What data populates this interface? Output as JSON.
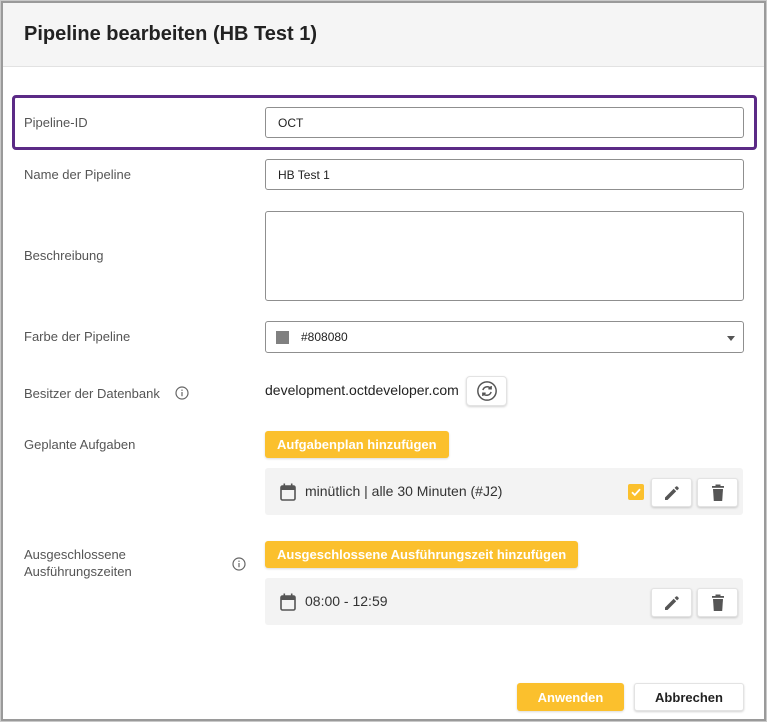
{
  "dialog": {
    "title": "Pipeline bearbeiten (HB Test 1)"
  },
  "fields": {
    "pipeline_id": {
      "label": "Pipeline-ID",
      "value": "OCT"
    },
    "name": {
      "label": "Name der Pipeline",
      "value": "HB Test 1"
    },
    "description": {
      "label": "Beschreibung",
      "value": ""
    },
    "color": {
      "label": "Farbe der Pipeline",
      "value": "#808080"
    },
    "owner": {
      "label": "Besitzer der Datenbank",
      "value": "development.octdeveloper.com"
    }
  },
  "scheduled_tasks": {
    "label": "Geplante Aufgaben",
    "add_button": "Aufgabenplan hinzufügen",
    "items": [
      {
        "text": "minütlich | alle 30 Minuten (#J2)",
        "checked": true
      }
    ]
  },
  "excluded_times": {
    "label_line1": "Ausgeschlossene",
    "label_line2": "Ausführungszeiten",
    "add_button": "Ausgeschlossene Ausführungszeit hinzufügen",
    "items": [
      {
        "text": "08:00 - 12:59"
      }
    ]
  },
  "footer": {
    "apply": "Anwenden",
    "cancel": "Abbrechen"
  },
  "icons": {
    "info": "info-icon",
    "sync": "sync-icon",
    "calendar": "calendar-icon",
    "edit": "pencil-icon",
    "delete": "trash-icon",
    "checkbox": "check-icon",
    "dropdown": "chevron-down-icon"
  },
  "colors": {
    "accent": "#fbc02d",
    "highlight": "#5b2a86",
    "swatch": "#808080"
  }
}
